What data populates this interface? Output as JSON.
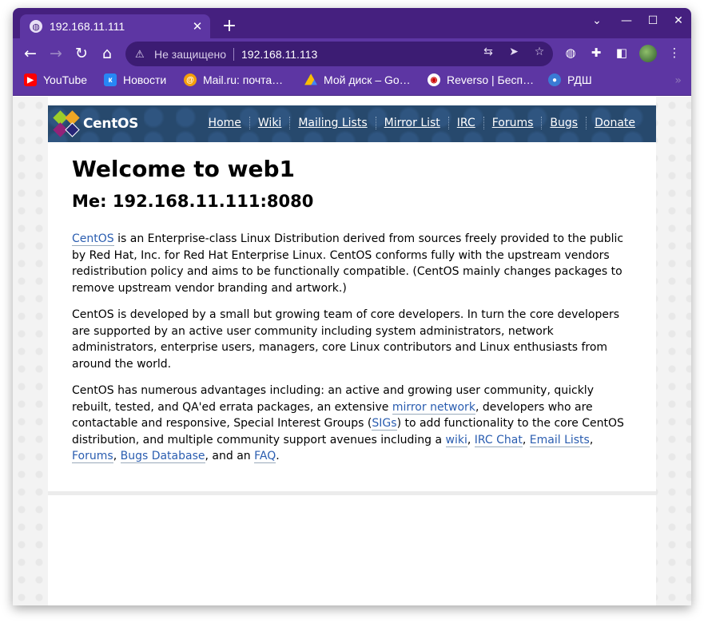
{
  "browser": {
    "tab_title": "192.168.11.111",
    "security_label": "Не защищено",
    "url": "192.168.11.113",
    "bookmarks": [
      {
        "label": "YouTube",
        "color": "#ff0000"
      },
      {
        "label": "Новости",
        "color": "#2787f5"
      },
      {
        "label": "Mail.ru: почта…",
        "color": "#1f6feb"
      },
      {
        "label": "Мой диск – Go…",
        "color": "#34a853"
      },
      {
        "label": "Reverso | Бесп…",
        "color": "#ffffff"
      },
      {
        "label": "РДШ",
        "color": "#3a7bd5"
      }
    ],
    "bookmarks_more": "»"
  },
  "site": {
    "logo_text": "CentOS",
    "nav": [
      "Home",
      "Wiki",
      "Mailing Lists",
      "Mirror List",
      "IRC",
      "Forums",
      "Bugs",
      "Donate"
    ]
  },
  "main": {
    "heading": "Welcome to web1",
    "subheading": "Me: 192.168.11.111:8080",
    "p1": {
      "link": "CentOS",
      "text": " is an Enterprise-class Linux Distribution derived from sources freely provided to the public by Red Hat, Inc. for Red Hat Enterprise Linux. CentOS conforms fully with the upstream vendors redistribution policy and aims to be functionally compatible. (CentOS mainly changes packages to remove upstream vendor branding and artwork.)"
    },
    "p2": "CentOS is developed by a small but growing team of core developers.  In turn the core developers are supported by an active user community including system administrators, network administrators, enterprise users, managers, core Linux contributors and Linux enthusiasts from around the world.",
    "p3": {
      "t1": "CentOS has numerous advantages including: an active and growing user community, quickly rebuilt, tested, and QA'ed errata packages, an extensive ",
      "l1": "mirror network",
      "t2": ", developers who are contactable and responsive, Special Interest Groups (",
      "l2": "SIGs",
      "t3": ") to add functionality to the core CentOS distribution, and multiple community support avenues including a ",
      "l3": "wiki",
      "t4": ", ",
      "l4": "IRC Chat",
      "t5": ", ",
      "l5": "Email Lists",
      "t6": ", ",
      "l6": "Forums",
      "t7": ", ",
      "l7": "Bugs Database",
      "t8": ", and an ",
      "l8": "FAQ",
      "t9": "."
    }
  }
}
